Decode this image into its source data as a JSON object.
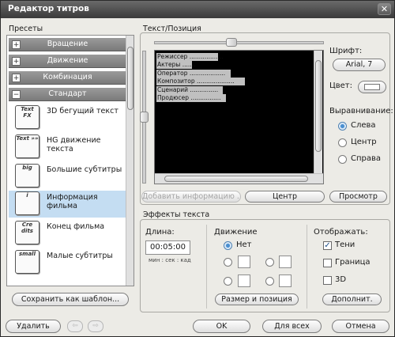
{
  "window": {
    "title": "Редактор титров",
    "close_glyph": "✕"
  },
  "presets": {
    "label": "Пресеты",
    "categories": [
      {
        "label": "Вращение",
        "expander": "+"
      },
      {
        "label": "Движение",
        "expander": "+"
      },
      {
        "label": "Комбинация",
        "expander": "+"
      },
      {
        "label": "Стандарт",
        "expander": "−"
      }
    ],
    "items": [
      {
        "label": "3D бегущий текст",
        "icon": "text-fx-icon",
        "icon_text": "Text FX"
      },
      {
        "label": "HG движение текста",
        "icon": "text-motion-icon",
        "icon_text": "Text »»"
      },
      {
        "label": "Большие субтитры",
        "icon": "big-subtitles-icon",
        "icon_text": "big"
      },
      {
        "label": "Информация фильма",
        "icon": "movie-info-icon",
        "icon_text": "i"
      },
      {
        "label": "Конец фильма",
        "icon": "credits-icon",
        "icon_text": "Cre dits"
      },
      {
        "label": "Малые субтитры",
        "icon": "small-subtitles-icon",
        "icon_text": "small"
      }
    ],
    "save_template_label": "Сохранить как шаблон..."
  },
  "text_position": {
    "label": "Текст/Позиция",
    "preview_lines": [
      "Режиссер ..................",
      "Актеры .......",
      "Оператор ...................",
      "Композитор ....................",
      "Сценарий ...............",
      "Продюсер ................"
    ],
    "add_info_label": "Добавить информацию ...",
    "center_label": "Центр",
    "preview_label": "Просмотр"
  },
  "font": {
    "label": "Шрифт:",
    "value": "Arial, 7"
  },
  "color": {
    "label": "Цвет:",
    "swatch": "#ffffff"
  },
  "alignment": {
    "label": "Выравнивание:",
    "options": [
      "Слева",
      "Центр",
      "Справа"
    ],
    "selected": "Слева"
  },
  "effects": {
    "label": "Эффекты текста",
    "duration_label": "Длина:",
    "duration_value": "00:05:00",
    "duration_units": "мин : сек : кад",
    "motion_label": "Движение",
    "motion_none_label": "Нет",
    "size_position_label": "Размер и позиция",
    "display_label": "Отображать:",
    "shadow_label": "Тени",
    "shadow_checked": true,
    "border_label": "Граница",
    "border_checked": false,
    "threed_label": "3D",
    "threed_checked": false,
    "more_label": "Дополнит."
  },
  "footer": {
    "delete_label": "Удалить",
    "prev_glyph": "⇦",
    "next_glyph": "⇨",
    "ok_label": "OK",
    "apply_all_label": "Для всех",
    "cancel_label": "Отмена"
  },
  "colors": {
    "titlebar": "#4a4a4a",
    "selection": "#c4ddf2",
    "category": "#8a8a8a",
    "preview_bg": "#000000"
  }
}
